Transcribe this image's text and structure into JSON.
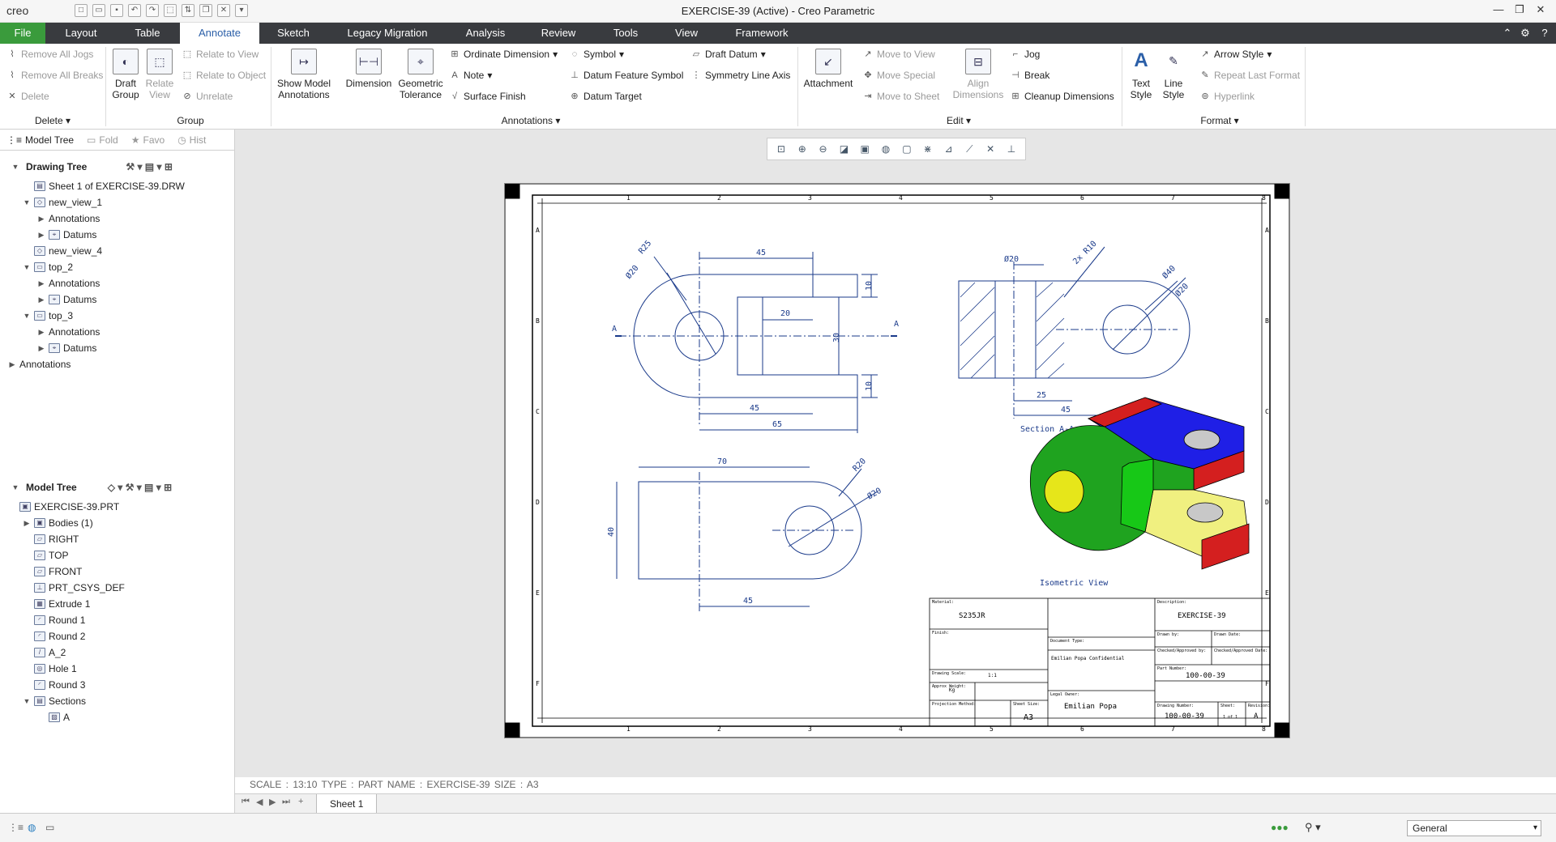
{
  "app": {
    "logo": "creo",
    "window_title": "EXERCISE-39 (Active) - Creo Parametric"
  },
  "menu": {
    "file": "File",
    "tabs": [
      "Layout",
      "Table",
      "Annotate",
      "Sketch",
      "Legacy Migration",
      "Analysis",
      "Review",
      "Tools",
      "View",
      "Framework"
    ],
    "active": "Annotate"
  },
  "ribbon": {
    "delete_group": {
      "items": [
        "Remove All Jogs",
        "Remove All Breaks",
        "Delete"
      ],
      "label": "Delete"
    },
    "group_group": {
      "draft_group": "Draft Group",
      "relate_view": "Relate View",
      "items": [
        "Relate to View",
        "Relate to Object",
        "Unrelate"
      ],
      "label": "Group"
    },
    "annotations": {
      "show_model": "Show Model Annotations",
      "dimension": "Dimension",
      "geometric_tolerance": "Geometric Tolerance",
      "items_col1": [
        "Ordinate Dimension",
        "Note",
        "Surface Finish"
      ],
      "items_col2": [
        "Symbol",
        "Datum Feature Symbol",
        "Datum Target"
      ],
      "items_col3": [
        "Draft Datum",
        "Symmetry Line Axis"
      ],
      "label": "Annotations"
    },
    "edit": {
      "attachment": "Attachment",
      "items_col1": [
        "Move to View",
        "Move Special",
        "Move to Sheet"
      ],
      "align": "Align Dimensions",
      "items_col2": [
        "Jog",
        "Break",
        "Cleanup Dimensions"
      ],
      "label": "Edit"
    },
    "format": {
      "text_style": "Text Style",
      "line_style": "Line Style",
      "items": [
        "Arrow Style",
        "Repeat Last Format",
        "Hyperlink"
      ],
      "label": "Format"
    }
  },
  "panel_tabs": [
    "Model Tree",
    "Fold",
    "Favo",
    "Hist"
  ],
  "drawing_tree": {
    "title": "Drawing Tree",
    "items": [
      {
        "label": "Sheet 1 of EXERCISE-39.DRW",
        "level": 0,
        "tw": "",
        "icon": "▤"
      },
      {
        "label": "new_view_1",
        "level": 0,
        "tw": "▼",
        "icon": "◇"
      },
      {
        "label": "Annotations",
        "level": 1,
        "tw": "▶",
        "icon": ""
      },
      {
        "label": "Datums",
        "level": 1,
        "tw": "▶",
        "icon": "⌖"
      },
      {
        "label": "new_view_4",
        "level": 0,
        "tw": "",
        "icon": "◇"
      },
      {
        "label": "top_2",
        "level": 0,
        "tw": "▼",
        "icon": "▭"
      },
      {
        "label": "Annotations",
        "level": 1,
        "tw": "▶",
        "icon": ""
      },
      {
        "label": "Datums",
        "level": 1,
        "tw": "▶",
        "icon": "⌖"
      },
      {
        "label": "top_3",
        "level": 0,
        "tw": "▼",
        "icon": "▭"
      },
      {
        "label": "Annotations",
        "level": 1,
        "tw": "▶",
        "icon": ""
      },
      {
        "label": "Datums",
        "level": 1,
        "tw": "▶",
        "icon": "⌖"
      },
      {
        "label": "Annotations",
        "level": -1,
        "tw": "▶",
        "icon": ""
      }
    ]
  },
  "model_tree": {
    "title": "Model Tree",
    "items": [
      {
        "label": "EXERCISE-39.PRT",
        "level": -1,
        "tw": "",
        "icon": "▣"
      },
      {
        "label": "Bodies (1)",
        "level": 0,
        "tw": "▶",
        "icon": "▣"
      },
      {
        "label": "RIGHT",
        "level": 0,
        "tw": "",
        "icon": "▱"
      },
      {
        "label": "TOP",
        "level": 0,
        "tw": "",
        "icon": "▱"
      },
      {
        "label": "FRONT",
        "level": 0,
        "tw": "",
        "icon": "▱"
      },
      {
        "label": "PRT_CSYS_DEF",
        "level": 0,
        "tw": "",
        "icon": "⊥"
      },
      {
        "label": "Extrude 1",
        "level": 0,
        "tw": "",
        "icon": "▦"
      },
      {
        "label": "Round 1",
        "level": 0,
        "tw": "",
        "icon": "◜"
      },
      {
        "label": "Round 2",
        "level": 0,
        "tw": "",
        "icon": "◜"
      },
      {
        "label": "A_2",
        "level": 0,
        "tw": "",
        "icon": "/"
      },
      {
        "label": "Hole 1",
        "level": 0,
        "tw": "",
        "icon": "◎"
      },
      {
        "label": "Round 3",
        "level": 0,
        "tw": "",
        "icon": "◜"
      },
      {
        "label": "Sections",
        "level": 0,
        "tw": "▼",
        "icon": "▤"
      },
      {
        "label": "A",
        "level": 1,
        "tw": "",
        "icon": "▨"
      }
    ]
  },
  "drawing": {
    "dims_top_left": [
      "45",
      "R25",
      "Ø20",
      "20",
      "30",
      "10",
      "10",
      "45",
      "65"
    ],
    "dims_top_right": [
      "Ø20",
      "2x R10",
      "Ø40",
      "Ø20",
      "25",
      "45"
    ],
    "dims_bottom_left": [
      "70",
      "R20",
      "Ø20",
      "40",
      "45"
    ],
    "section_label": "Section A-A",
    "iso_label": "Isometric View",
    "cut_label": "A",
    "zone_cols": [
      "1",
      "2",
      "3",
      "4",
      "5",
      "6",
      "7",
      "8"
    ],
    "zone_rows": [
      "A",
      "B",
      "C",
      "D",
      "E",
      "F"
    ],
    "title_block": {
      "material": "S235JR",
      "description": "EXERCISE-39",
      "part_number": "100-00-39",
      "drawing_number": "100-00-39",
      "revision": "A",
      "sheet_size": "A3",
      "author": "Emilian Popa",
      "confidential": "Emilian Popa Confidential",
      "scale": "1:1",
      "weight": "Kg",
      "sheet": "1 of 1",
      "label_material": "Material:",
      "label_description": "Description:",
      "label_finish": "Finish:",
      "label_drawn": "Drawn by:",
      "label_drawn_date": "Drawn Date:",
      "label_checked": "Checked/Approved by:",
      "label_checked_date": "Checked/Approved Date:",
      "label_part": "Part Number:",
      "label_drawing": "Drawing Number:",
      "label_sheet_size": "Sheet Size:",
      "label_doc_type": "Document Type:",
      "label_legal": "Legal Owner:",
      "label_scale": "Drawing Scale:",
      "label_weight": "Approx Weight:",
      "label_projection": "Projection Method:",
      "label_sheet": "Sheet:",
      "label_revision": "Revision:"
    }
  },
  "status_info": "SCALE : 13:10   TYPE : PART   NAME : EXERCISE-39   SIZE : A3",
  "sheet_tab": "Sheet 1",
  "filter": "General",
  "colors": {
    "menubar": "#393b3f",
    "file_green": "#3a9b3c",
    "iso_green": "#1fa31f",
    "iso_blue": "#1f1fe6",
    "iso_red": "#d41f1f",
    "iso_yellow": "#f0f080"
  }
}
